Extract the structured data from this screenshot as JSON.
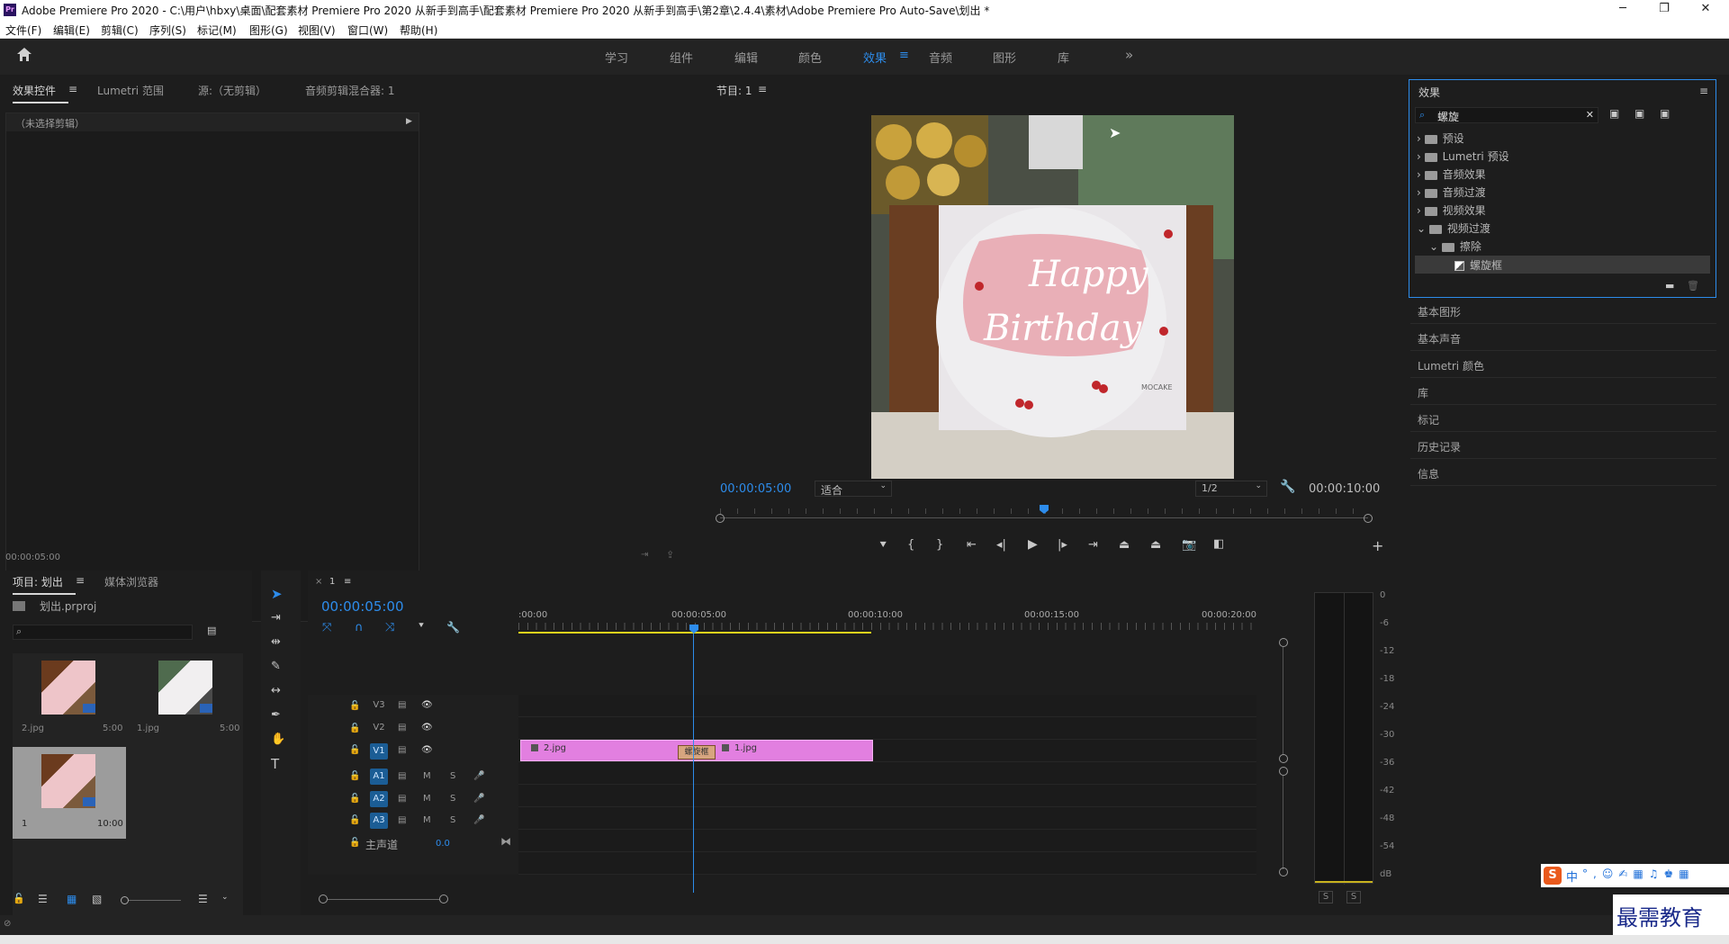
{
  "window": {
    "title": "Adobe Premiere Pro 2020 - C:\\用户\\hbxy\\桌面\\配套素材 Premiere Pro 2020 从新手到高手\\配套素材 Premiere Pro 2020 从新手到高手\\第2章\\2.4.4\\素材\\Adobe Premiere Pro Auto-Save\\划出 *",
    "app_icon": "Pr",
    "minimize": "─",
    "restore": "❐",
    "close": "✕"
  },
  "menu": [
    "文件(F)",
    "编辑(E)",
    "剪辑(C)",
    "序列(S)",
    "标记(M)",
    "图形(G)",
    "视图(V)",
    "窗口(W)",
    "帮助(H)"
  ],
  "workspaces": [
    "学习",
    "组件",
    "编辑",
    "颜色",
    "效果",
    "音频",
    "图形",
    "库"
  ],
  "workspace_active": "效果",
  "workspace_more": "»",
  "source_panel": {
    "tabs": [
      "效果控件",
      "Lumetri 范围",
      "源:（无剪辑）",
      "音频剪辑混合器: 1"
    ],
    "no_clip": "（未选择剪辑）",
    "timecode": "00:00:05:00"
  },
  "program": {
    "title": "节目: 1",
    "timecode": "00:00:05:00",
    "fit": "适合",
    "resolution": "1/2",
    "duration": "00:00:10:00",
    "playhead_fraction": 0.5
  },
  "preview_text": {
    "line1": "Happy",
    "line2": "Birthday",
    "brand": "MOCAKE"
  },
  "effects": {
    "title": "效果",
    "search_value": "螺旋",
    "clear": "✕",
    "tree": [
      {
        "label": "预设",
        "level": 0,
        "expanded": false
      },
      {
        "label": "Lumetri 预设",
        "level": 0,
        "expanded": false
      },
      {
        "label": "音频效果",
        "level": 0,
        "expanded": false
      },
      {
        "label": "音频过渡",
        "level": 0,
        "expanded": false
      },
      {
        "label": "视频效果",
        "level": 0,
        "expanded": false
      },
      {
        "label": "视频过渡",
        "level": 0,
        "expanded": true
      },
      {
        "label": "擦除",
        "level": 1,
        "expanded": true
      },
      {
        "label": "螺旋框",
        "level": 2,
        "selected": true
      }
    ],
    "sections": [
      "基本图形",
      "基本声音",
      "Lumetri 颜色",
      "库",
      "标记",
      "历史记录",
      "信息"
    ]
  },
  "project": {
    "tabs": [
      "项目: 划出",
      "媒体浏览器"
    ],
    "file": "划出.prproj",
    "items": [
      {
        "name": "2.jpg",
        "duration": "5:00"
      },
      {
        "name": "1.jpg",
        "duration": "5:00"
      },
      {
        "name": "1",
        "duration": "10:00"
      }
    ]
  },
  "timeline": {
    "tab": "1",
    "timecode": "00:00:05:00",
    "ruler": [
      ":00:00",
      "00:00:05:00",
      "00:00:10:00",
      "00:00:15:00",
      "00:00:20:00"
    ],
    "video_tracks": [
      "V3",
      "V2",
      "V1"
    ],
    "audio_tracks": [
      "A1",
      "A2",
      "A3"
    ],
    "master": "主声道",
    "master_value": "0.0",
    "clip_a": "2.jpg",
    "clip_b": "1.jpg",
    "transition": "螺旋框"
  },
  "meter": {
    "scale": [
      "0",
      "-6",
      "-12",
      "-18",
      "-24",
      "-30",
      "-36",
      "-42",
      "-48",
      "-54",
      "dB"
    ],
    "solo": [
      "S",
      "S"
    ]
  },
  "ime": {
    "logo": "S",
    "lang": "中"
  },
  "watermark": "最需教育",
  "colors": {
    "accent": "#2d8ceb",
    "clip": "#e27fe0",
    "bg": "#1d1d1d"
  }
}
